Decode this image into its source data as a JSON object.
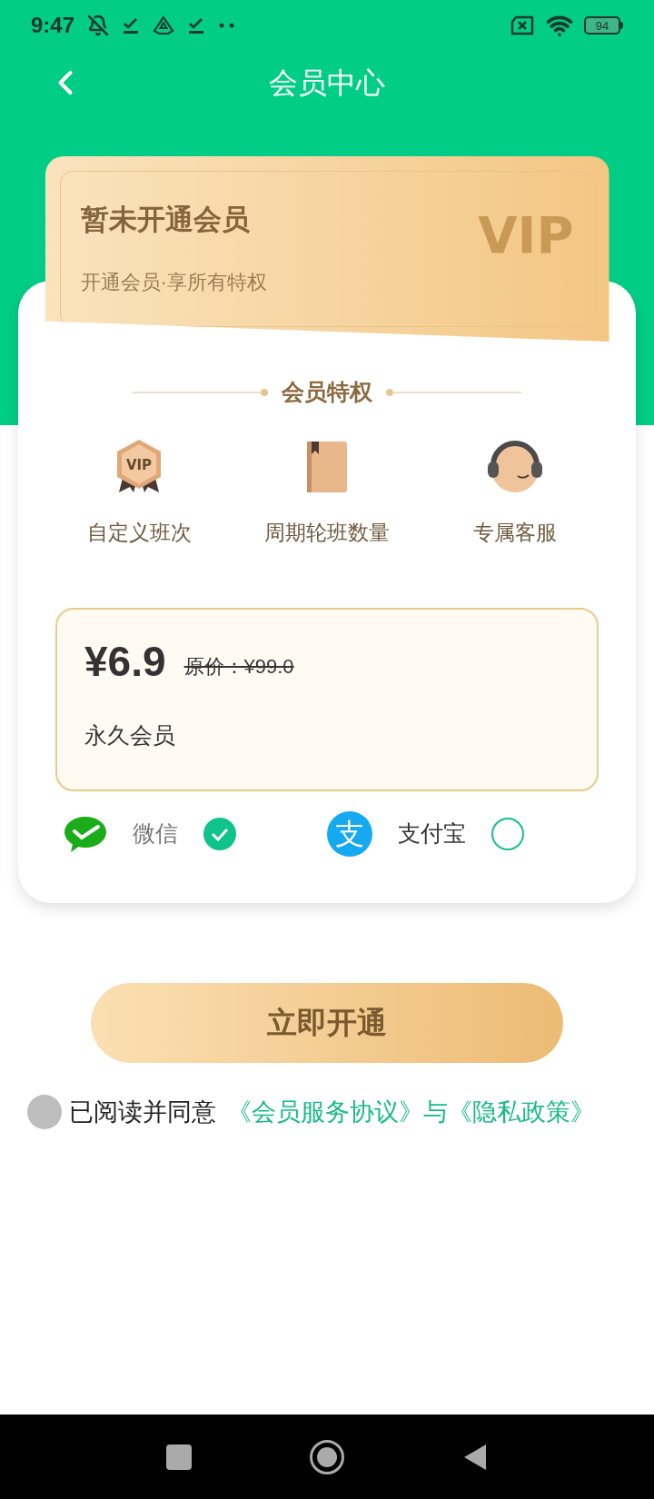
{
  "status_bar": {
    "time": "9:47",
    "battery": "94"
  },
  "header": {
    "title": "会员中心"
  },
  "membership_card": {
    "title": "暂未开通会员",
    "subtitle": "开通会员·享所有特权",
    "badge": "VIP"
  },
  "benefits": {
    "title": "会员特权",
    "items": [
      {
        "kind": "vip",
        "label": "自定义班次",
        "icon_text": "VIP"
      },
      {
        "kind": "book",
        "label": "周期轮班数量"
      },
      {
        "kind": "service",
        "label": "专属客服"
      }
    ]
  },
  "plan": {
    "price": "¥6.9",
    "original_price": "原价：¥99.0",
    "name": "永久会员",
    "selected": true
  },
  "payment_methods": [
    {
      "kind": "wechat",
      "label": "微信",
      "selected": true
    },
    {
      "kind": "alipay",
      "label": "支付宝",
      "icon_text": "支",
      "selected": false
    }
  ],
  "submit": {
    "label": "立即开通"
  },
  "agreement": {
    "checked": false,
    "text": "已阅读并同意",
    "links": "《会员服务协议》与《隐私政策》"
  }
}
